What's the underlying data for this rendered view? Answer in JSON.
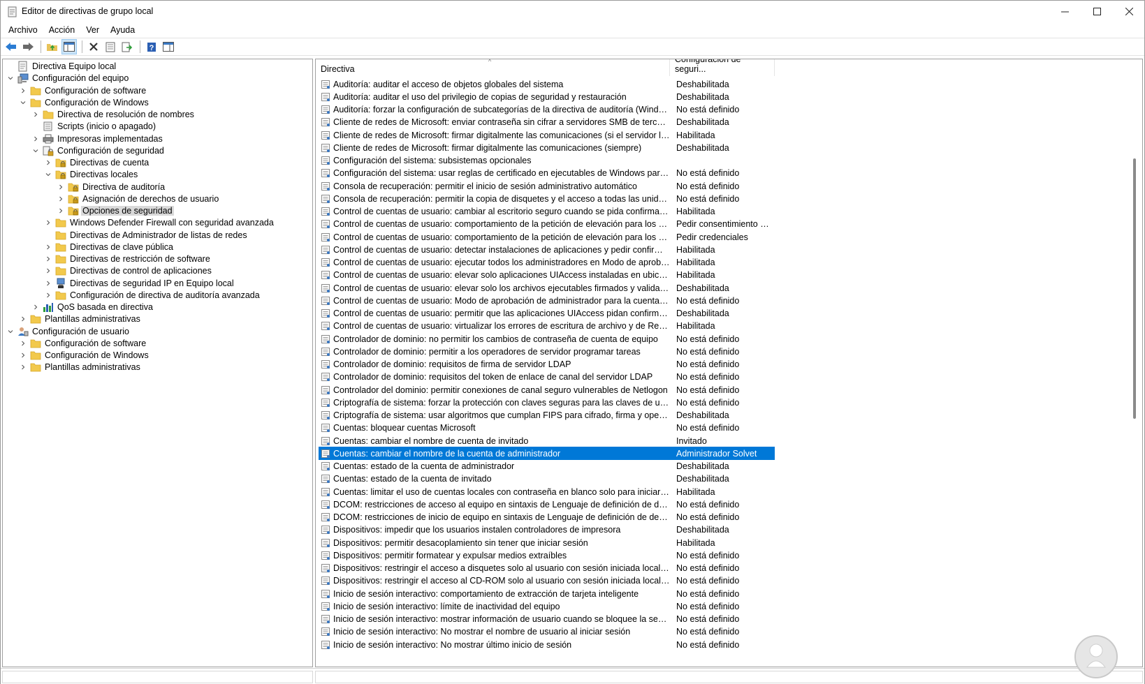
{
  "window": {
    "title": "Editor de directivas de grupo local"
  },
  "menu": [
    "Archivo",
    "Acción",
    "Ver",
    "Ayuda"
  ],
  "tree": [
    {
      "label": "Directiva Equipo local",
      "indent": 0,
      "chev": "",
      "icon": "policy"
    },
    {
      "label": "Configuración del equipo",
      "indent": 0,
      "chev": "down",
      "icon": "computer"
    },
    {
      "label": "Configuración de software",
      "indent": 1,
      "chev": "right",
      "icon": "folder"
    },
    {
      "label": "Configuración de Windows",
      "indent": 1,
      "chev": "down",
      "icon": "folder"
    },
    {
      "label": "Directiva de resolución de nombres",
      "indent": 2,
      "chev": "right",
      "icon": "folder"
    },
    {
      "label": "Scripts (inicio o apagado)",
      "indent": 2,
      "chev": "",
      "icon": "script"
    },
    {
      "label": "Impresoras implementadas",
      "indent": 2,
      "chev": "right",
      "icon": "printer"
    },
    {
      "label": "Configuración de seguridad",
      "indent": 2,
      "chev": "down",
      "icon": "security"
    },
    {
      "label": "Directivas de cuenta",
      "indent": 3,
      "chev": "right",
      "icon": "lockfolder"
    },
    {
      "label": "Directivas locales",
      "indent": 3,
      "chev": "down",
      "icon": "lockfolder"
    },
    {
      "label": "Directiva de auditoría",
      "indent": 4,
      "chev": "right",
      "icon": "lockfolder"
    },
    {
      "label": "Asignación de derechos de usuario",
      "indent": 4,
      "chev": "right",
      "icon": "lockfolder"
    },
    {
      "label": "Opciones de seguridad",
      "indent": 4,
      "chev": "right",
      "icon": "lockfolder",
      "selected": true
    },
    {
      "label": "Windows Defender Firewall con seguridad avanzada",
      "indent": 3,
      "chev": "right",
      "icon": "folder"
    },
    {
      "label": "Directivas de Administrador de listas de redes",
      "indent": 3,
      "chev": "",
      "icon": "folder"
    },
    {
      "label": "Directivas de clave pública",
      "indent": 3,
      "chev": "right",
      "icon": "folder"
    },
    {
      "label": "Directivas de restricción de software",
      "indent": 3,
      "chev": "right",
      "icon": "folder"
    },
    {
      "label": "Directivas de control de aplicaciones",
      "indent": 3,
      "chev": "right",
      "icon": "folder"
    },
    {
      "label": "Directivas de seguridad IP en Equipo local",
      "indent": 3,
      "chev": "right",
      "icon": "ipsec"
    },
    {
      "label": "Configuración de directiva de auditoría avanzada",
      "indent": 3,
      "chev": "right",
      "icon": "folder"
    },
    {
      "label": "QoS basada en directiva",
      "indent": 2,
      "chev": "right",
      "icon": "chart"
    },
    {
      "label": "Plantillas administrativas",
      "indent": 1,
      "chev": "right",
      "icon": "folder"
    },
    {
      "label": "Configuración de usuario",
      "indent": 0,
      "chev": "down",
      "icon": "user"
    },
    {
      "label": "Configuración de software",
      "indent": 1,
      "chev": "right",
      "icon": "folder"
    },
    {
      "label": "Configuración de Windows",
      "indent": 1,
      "chev": "right",
      "icon": "folder"
    },
    {
      "label": "Plantillas administrativas",
      "indent": 1,
      "chev": "right",
      "icon": "folder"
    }
  ],
  "columns": {
    "policy": "Directiva",
    "setting": "Configuración de seguri..."
  },
  "rows": [
    {
      "name": "Auditoría: auditar el acceso de objetos globales del sistema",
      "value": "Deshabilitada"
    },
    {
      "name": "Auditoría: auditar el uso del privilegio de copias de seguridad y restauración",
      "value": "Deshabilitada"
    },
    {
      "name": "Auditoría: forzar la configuración de subcategorías de la directiva de auditoría (Windows V...",
      "value": "No está definido"
    },
    {
      "name": "Cliente de redes de Microsoft: enviar contraseña sin cifrar a servidores SMB de terceros",
      "value": "Deshabilitada"
    },
    {
      "name": "Cliente de redes de Microsoft: firmar digitalmente las comunicaciones (si el servidor lo per...",
      "value": "Habilitada"
    },
    {
      "name": "Cliente de redes de Microsoft: firmar digitalmente las comunicaciones (siempre)",
      "value": "Deshabilitada"
    },
    {
      "name": "Configuración del sistema: subsistemas opcionales",
      "value": ""
    },
    {
      "name": "Configuración del sistema: usar reglas de certificado en ejecutables de Windows para dire...",
      "value": "No está definido"
    },
    {
      "name": "Consola de recuperación: permitir el inicio de sesión administrativo automático",
      "value": "No está definido"
    },
    {
      "name": "Consola de recuperación: permitir la copia de disquetes y el acceso a todas las unidades y ...",
      "value": "No está definido"
    },
    {
      "name": "Control de cuentas de usuario: cambiar al escritorio seguro cuando se pida confirmación ...",
      "value": "Habilitada"
    },
    {
      "name": "Control de cuentas de usuario: comportamiento de la petición de elevación para los admi...",
      "value": "Pedir consentimiento pa..."
    },
    {
      "name": "Control de cuentas de usuario: comportamiento de la petición de elevación para los usuar...",
      "value": "Pedir credenciales"
    },
    {
      "name": "Control de cuentas de usuario: detectar instalaciones de aplicaciones y pedir confirmació...",
      "value": "Habilitada"
    },
    {
      "name": "Control de cuentas de usuario: ejecutar todos los administradores en Modo de aprobació...",
      "value": "Habilitada"
    },
    {
      "name": "Control de cuentas de usuario: elevar solo aplicaciones UIAccess instaladas en ubicacione...",
      "value": "Habilitada"
    },
    {
      "name": "Control de cuentas de usuario: elevar solo los archivos ejecutables firmados y validados",
      "value": "Deshabilitada"
    },
    {
      "name": "Control de cuentas de usuario: Modo de aprobación de administrador para la cuenta pred...",
      "value": "No está definido"
    },
    {
      "name": "Control de cuentas de usuario: permitir que las aplicaciones UIAccess pidan confirmación ...",
      "value": "Deshabilitada"
    },
    {
      "name": "Control de cuentas de usuario: virtualizar los errores de escritura de archivo y de Registro e...",
      "value": "Habilitada"
    },
    {
      "name": "Controlador de dominio: no permitir los cambios de contraseña de cuenta de equipo",
      "value": "No está definido"
    },
    {
      "name": "Controlador de dominio: permitir a los operadores de servidor programar tareas",
      "value": "No está definido"
    },
    {
      "name": "Controlador de dominio: requisitos de firma de servidor LDAP",
      "value": "No está definido"
    },
    {
      "name": "Controlador de dominio: requisitos del token de enlace de canal del servidor LDAP",
      "value": "No está definido"
    },
    {
      "name": "Controlador del dominio: permitir conexiones de canal seguro vulnerables de Netlogon",
      "value": "No está definido"
    },
    {
      "name": "Criptografía de sistema: forzar la protección con claves seguras para las claves de usuario ...",
      "value": "No está definido"
    },
    {
      "name": "Criptografía de sistema: usar algoritmos que cumplan FIPS para cifrado, firma y operacion...",
      "value": "Deshabilitada"
    },
    {
      "name": "Cuentas: bloquear cuentas Microsoft",
      "value": "No está definido"
    },
    {
      "name": "Cuentas: cambiar el nombre de cuenta de invitado",
      "value": "Invitado"
    },
    {
      "name": "Cuentas: cambiar el nombre de la cuenta de administrador",
      "value": "Administrador Solvet",
      "selected": true
    },
    {
      "name": "Cuentas: estado de la cuenta de administrador",
      "value": "Deshabilitada"
    },
    {
      "name": "Cuentas: estado de la cuenta de invitado",
      "value": "Deshabilitada"
    },
    {
      "name": "Cuentas: limitar el uso de cuentas locales con contraseña en blanco solo para iniciar sesió...",
      "value": "Habilitada"
    },
    {
      "name": "DCOM: restricciones de acceso al equipo en sintaxis de Lenguaje de definición de descript...",
      "value": "No está definido"
    },
    {
      "name": "DCOM: restricciones de inicio de equipo en sintaxis de Lenguaje de definición de descript...",
      "value": "No está definido"
    },
    {
      "name": "Dispositivos: impedir que los usuarios instalen controladores de impresora",
      "value": "Deshabilitada"
    },
    {
      "name": "Dispositivos: permitir desacoplamiento sin tener que iniciar sesión",
      "value": "Habilitada"
    },
    {
      "name": "Dispositivos: permitir formatear y expulsar medios extraíbles",
      "value": "No está definido"
    },
    {
      "name": "Dispositivos: restringir el acceso a disquetes solo al usuario con sesión iniciada localmente",
      "value": "No está definido"
    },
    {
      "name": "Dispositivos: restringir el acceso al CD-ROM solo al usuario con sesión iniciada localmente",
      "value": "No está definido"
    },
    {
      "name": "Inicio de sesión interactivo: comportamiento de extracción de tarjeta inteligente",
      "value": "No está definido"
    },
    {
      "name": "Inicio de sesión interactivo: límite de inactividad del equipo",
      "value": "No está definido"
    },
    {
      "name": "Inicio de sesión interactivo: mostrar información de usuario cuando se bloquee la sesión",
      "value": "No está definido"
    },
    {
      "name": "Inicio de sesión interactivo: No mostrar el nombre de usuario al iniciar sesión",
      "value": "No está definido"
    },
    {
      "name": "Inicio de sesión interactivo: No mostrar último inicio de sesión",
      "value": "No está definido"
    }
  ]
}
